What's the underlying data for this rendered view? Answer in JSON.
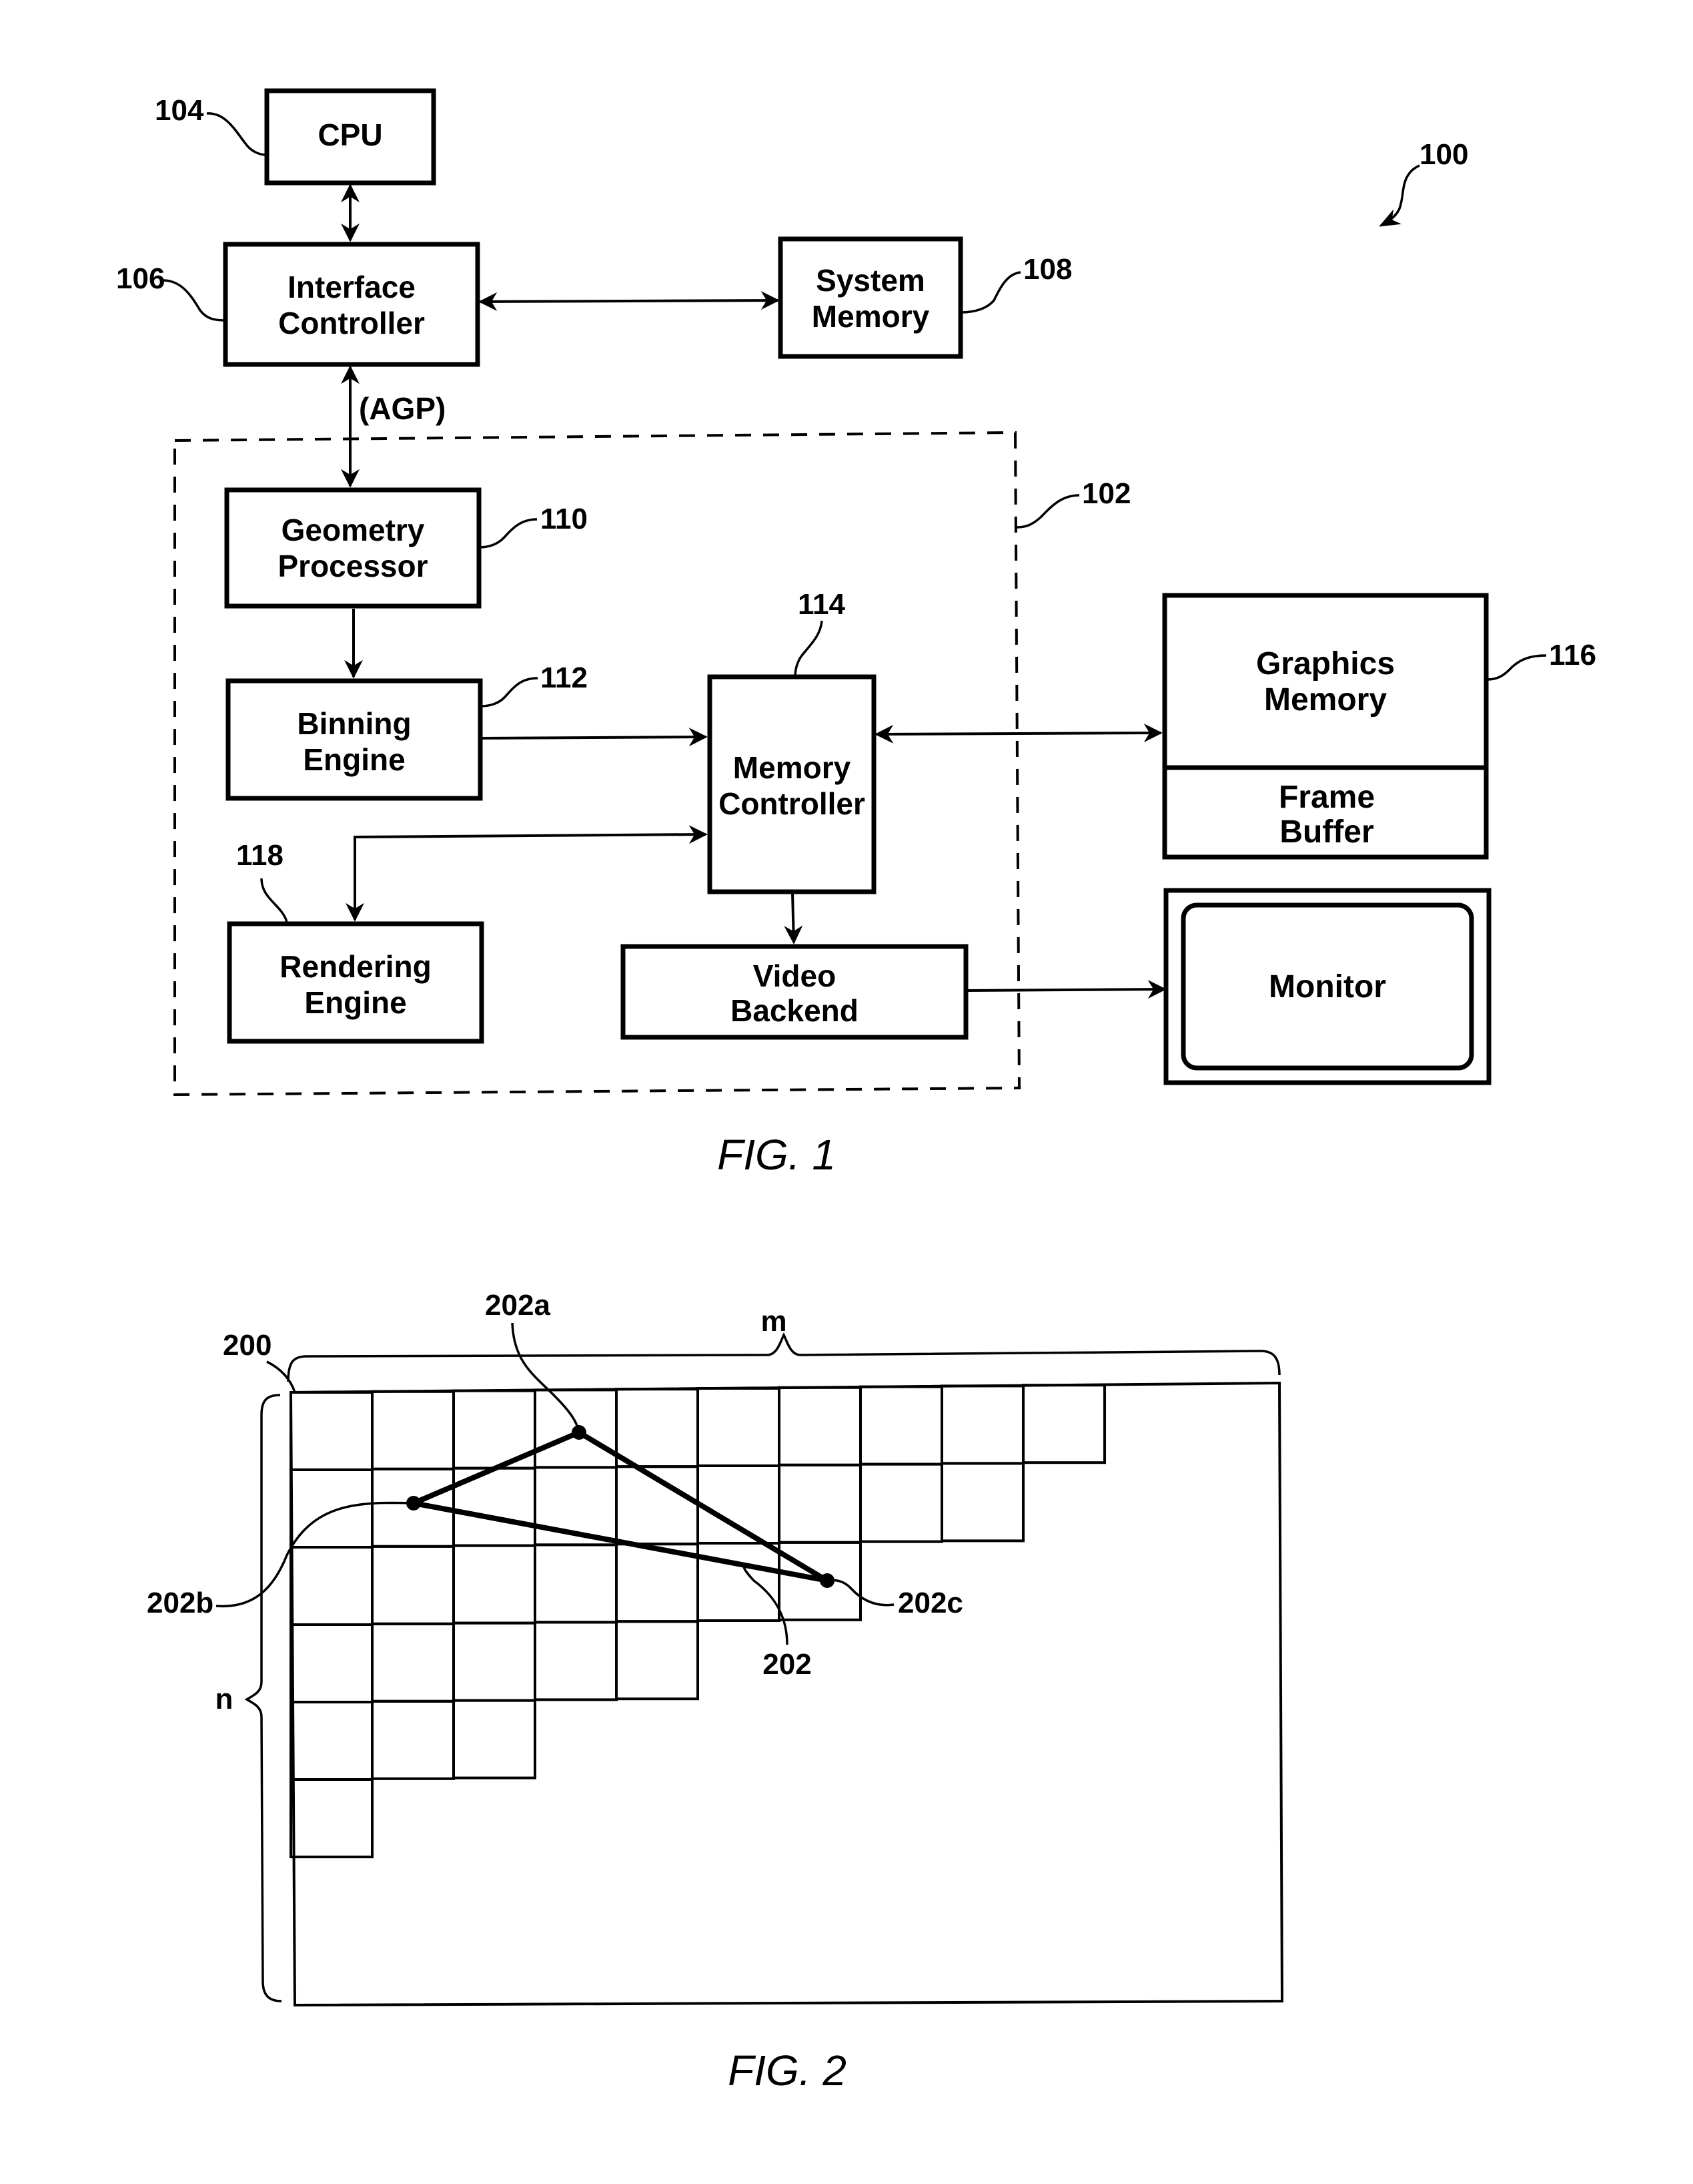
{
  "figure1": {
    "caption": "FIG. 1",
    "system_ref": "100",
    "graphics_subsystem_ref": "102",
    "bus_label": "(AGP)",
    "blocks": {
      "cpu": {
        "line1": "CPU",
        "ref": "104"
      },
      "interface_controller": {
        "line1": "Interface",
        "line2": "Controller",
        "ref": "106"
      },
      "system_memory": {
        "line1": "System",
        "line2": "Memory",
        "ref": "108"
      },
      "geometry_processor": {
        "line1": "Geometry",
        "line2": "Processor",
        "ref": "110"
      },
      "binning_engine": {
        "line1": "Binning",
        "line2": "Engine",
        "ref": "112"
      },
      "memory_controller": {
        "line1": "Memory",
        "line2": "Controller",
        "ref": "114"
      },
      "graphics_memory": {
        "line1": "Graphics",
        "line2": "Memory",
        "ref": "116"
      },
      "frame_buffer": {
        "line1": "Frame",
        "line2": "Buffer"
      },
      "rendering_engine": {
        "line1": "Rendering",
        "line2": "Engine",
        "ref": "118"
      },
      "video_backend": {
        "line1": "Video",
        "line2": "Backend"
      },
      "monitor": {
        "line1": "Monitor"
      }
    }
  },
  "figure2": {
    "caption": "FIG. 2",
    "screen_ref": "200",
    "width_label": "m",
    "height_label": "n",
    "triangle_ref": "202",
    "vertices": {
      "a": "202a",
      "b": "202b",
      "c": "202c"
    },
    "tile_row_counts": [
      10,
      9,
      7,
      5,
      3,
      1
    ]
  }
}
